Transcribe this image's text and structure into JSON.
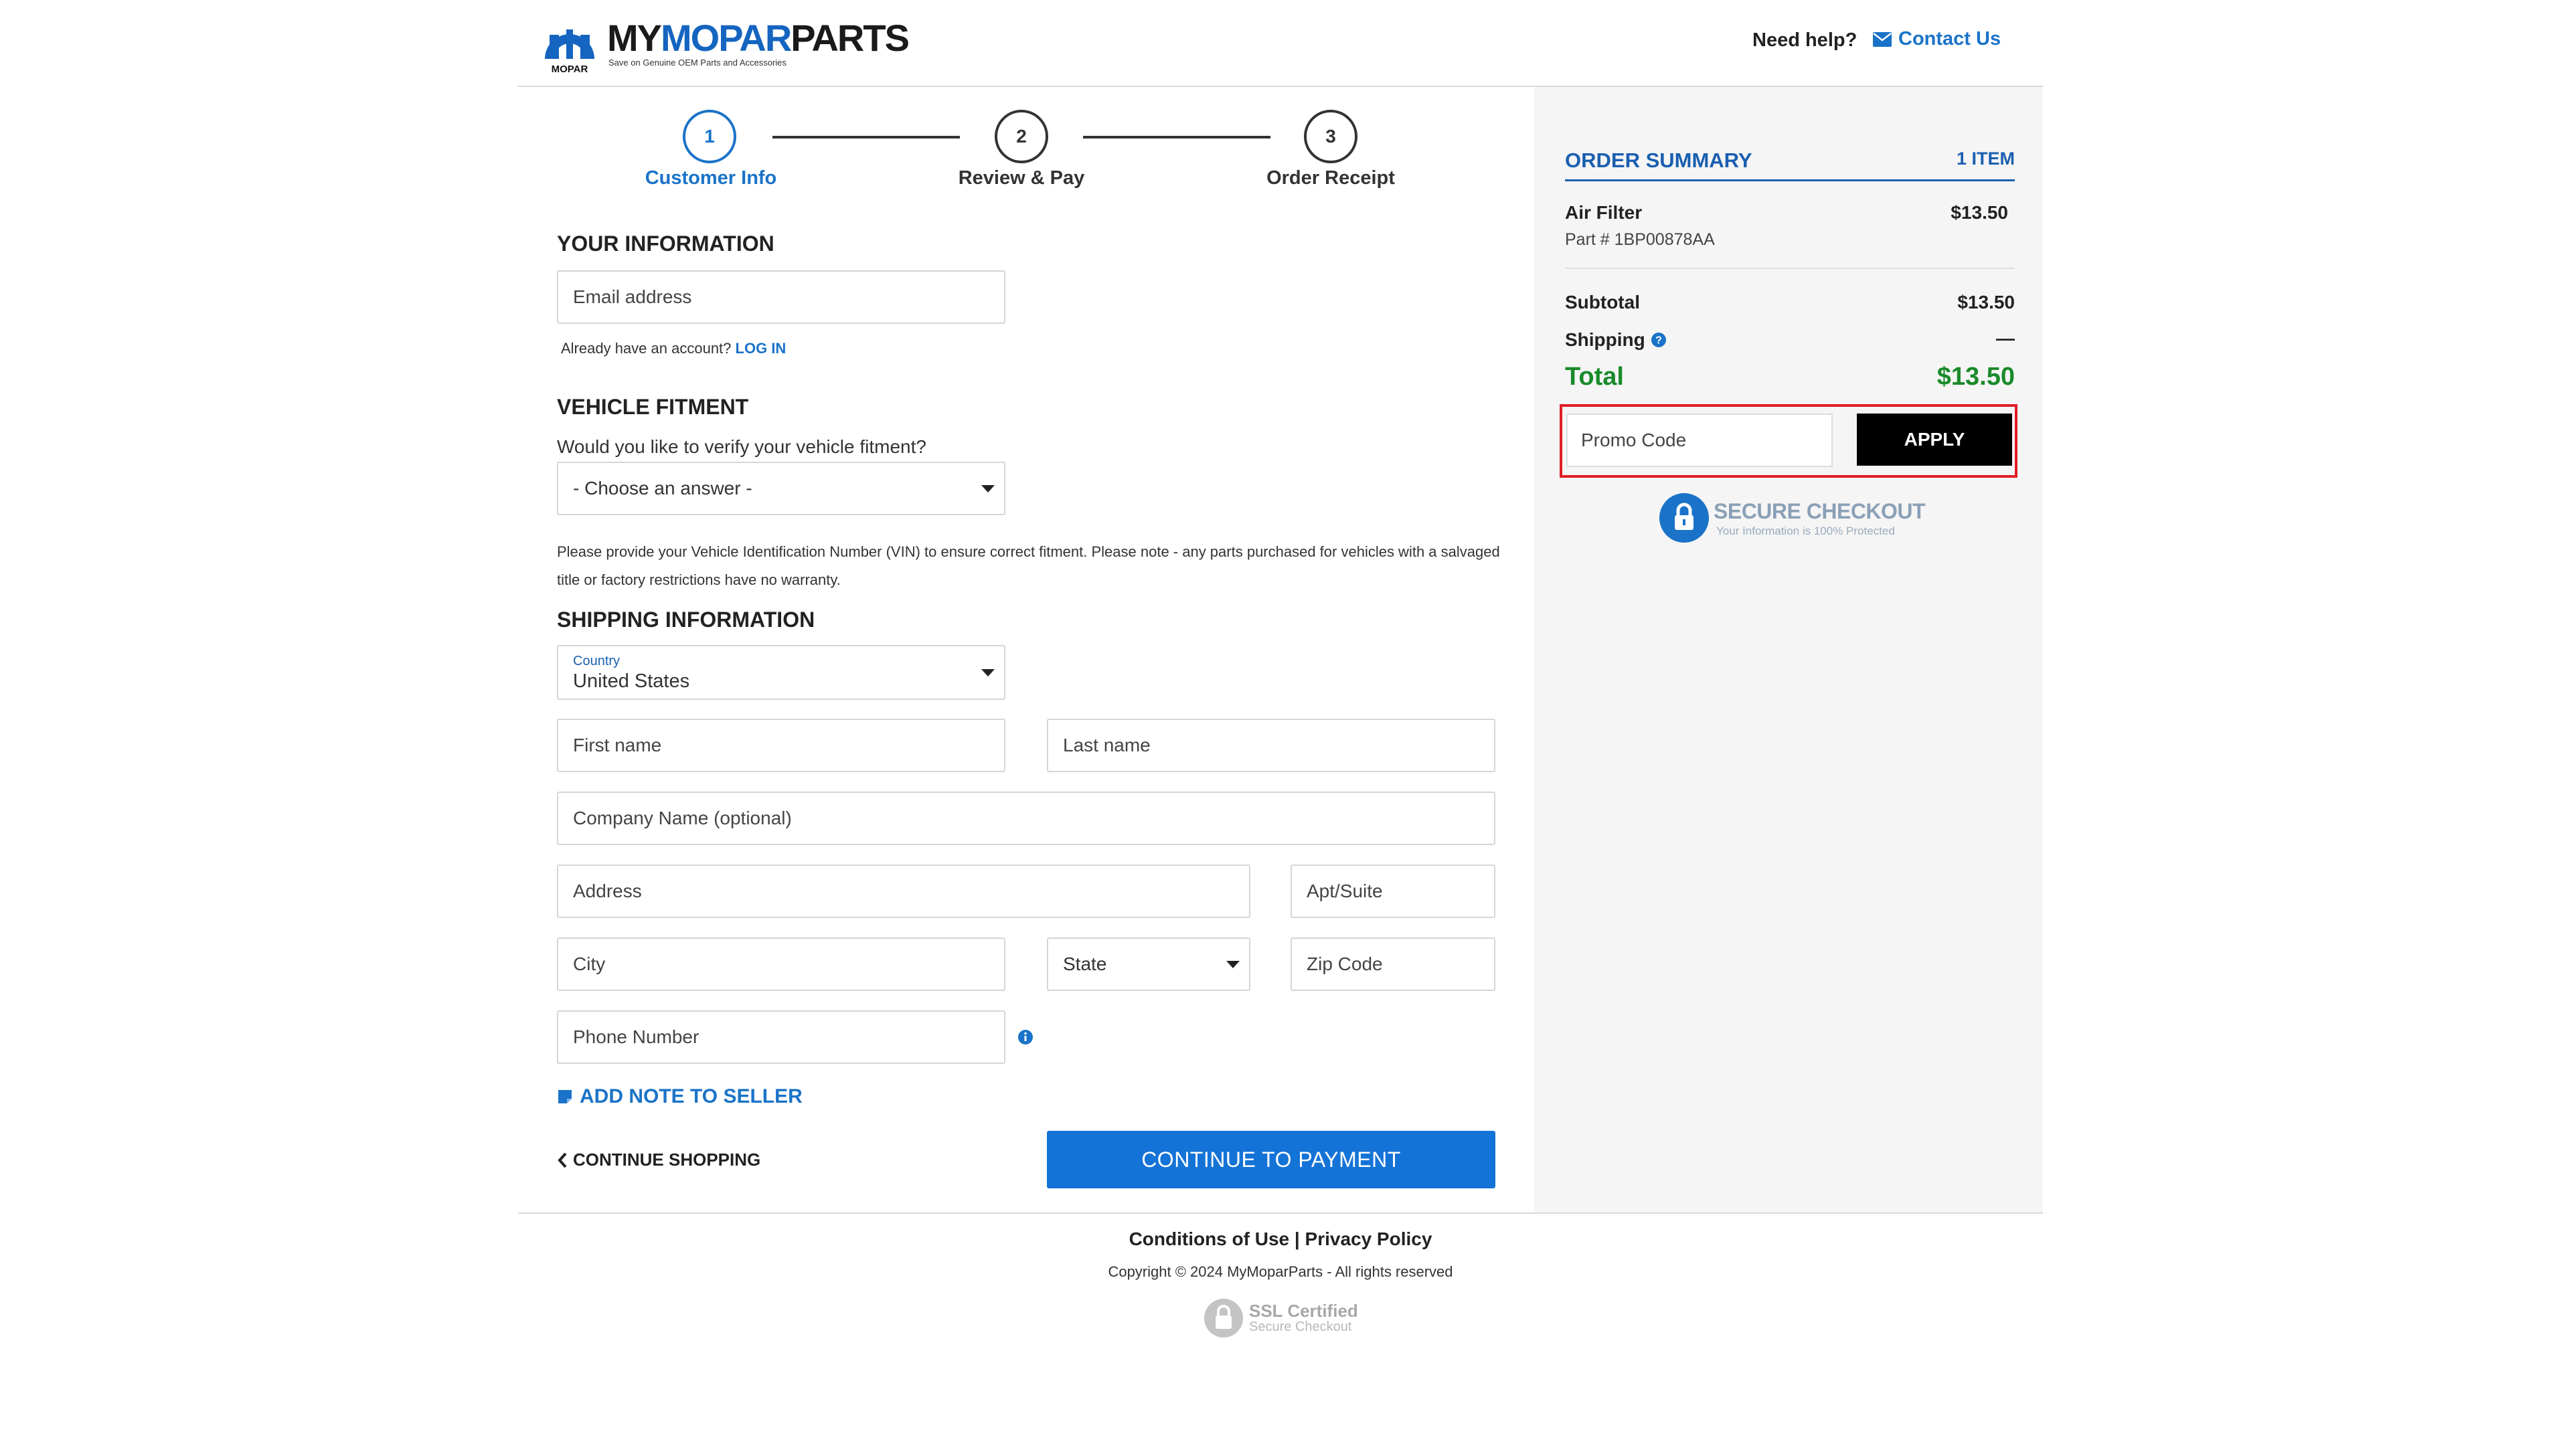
{
  "header": {
    "brand_my": "MY",
    "brand_mopar": "MOPAR",
    "brand_parts": "PARTS",
    "logo_mark_text": "MOPAR",
    "tagline": "Save on Genuine OEM Parts and Accessories",
    "help_text": "Need help?",
    "contact_label": "Contact Us"
  },
  "stepper": {
    "steps": [
      {
        "number": "1",
        "label": "Customer Info",
        "state": "active"
      },
      {
        "number": "2",
        "label": "Review & Pay",
        "state": "inactive"
      },
      {
        "number": "3",
        "label": "Order Receipt",
        "state": "inactive"
      }
    ]
  },
  "form": {
    "your_info_heading": "YOUR INFORMATION",
    "email_placeholder": "Email address",
    "already_account": "Already have an account?",
    "log_in": "LOG IN",
    "vehicle_heading": "VEHICLE FITMENT",
    "fitment_question": "Would you like to verify your vehicle fitment?",
    "fitment_selected": "- Choose an answer -",
    "vin_note": "Please provide your Vehicle Identification Number (VIN) to ensure correct fitment. Please note - any parts purchased for vehicles with a salvaged title or factory restrictions have no warranty.",
    "shipping_heading": "SHIPPING INFORMATION",
    "country_label": "Country",
    "country_value": "United States",
    "first_name_placeholder": "First name",
    "last_name_placeholder": "Last name",
    "company_placeholder": "Company Name (optional)",
    "address_placeholder": "Address",
    "apt_placeholder": "Apt/Suite",
    "city_placeholder": "City",
    "state_selected": "State",
    "zip_placeholder": "Zip Code",
    "phone_placeholder": "Phone Number",
    "add_note": "ADD NOTE TO SELLER",
    "continue_shopping": "CONTINUE SHOPPING",
    "continue_payment": "CONTINUE TO PAYMENT"
  },
  "order_summary": {
    "title": "ORDER SUMMARY",
    "item_count": "1 ITEM",
    "items": [
      {
        "name": "Air Filter",
        "part": "Part # 1BP00878AA",
        "price": "$13.50"
      }
    ],
    "subtotal_label": "Subtotal",
    "subtotal_value": "$13.50",
    "shipping_label": "Shipping",
    "shipping_value": "—",
    "total_label": "Total",
    "total_value": "$13.50",
    "promo_placeholder": "Promo Code",
    "apply_label": "APPLY",
    "secure_title": "SECURE CHECKOUT",
    "secure_sub": "Your Information is 100% Protected"
  },
  "footer": {
    "conditions": "Conditions of Use",
    "separator": " | ",
    "privacy": "Privacy Policy",
    "copyright": "Copyright © 2024 MyMoparParts - All rights reserved",
    "ssl_title": "SSL Certified",
    "ssl_sub": "Secure Checkout"
  },
  "colors": {
    "brand_blue": "#1a73c8",
    "total_green": "#1a8a2a",
    "highlight_red": "#e01e26",
    "primary_button": "#1473d6"
  }
}
